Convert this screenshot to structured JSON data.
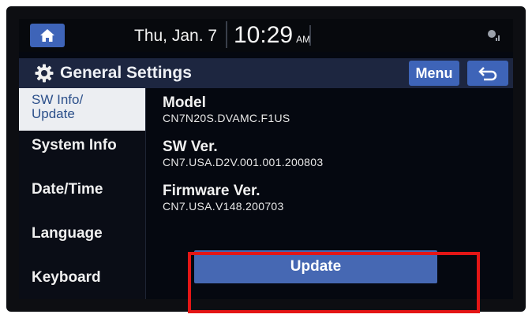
{
  "header": {
    "date": "Thu, Jan. 7",
    "time": "10:29",
    "ampm": "AM"
  },
  "titlebar": {
    "title": "General Settings",
    "menu_label": "Menu"
  },
  "sidebar": {
    "items": [
      {
        "label_line1": "SW Info/",
        "label_line2": "Update",
        "active": true
      },
      {
        "label": "System Info"
      },
      {
        "label": "Date/Time"
      },
      {
        "label": "Language"
      },
      {
        "label": "Keyboard"
      }
    ]
  },
  "info": {
    "model_label": "Model",
    "model_value": "CN7N20S.DVAMC.F1US",
    "sw_label": "SW Ver.",
    "sw_value": "CN7.USA.D2V.001.001.200803",
    "fw_label": "Firmware Ver.",
    "fw_value": "CN7.USA.V148.200703"
  },
  "update_button": "Update",
  "colors": {
    "accent": "#3e64b8",
    "highlight": "#e41616",
    "background": "#050810"
  },
  "icons": [
    "home-icon",
    "gear-icon",
    "back-arrow-icon",
    "signal-icon"
  ]
}
